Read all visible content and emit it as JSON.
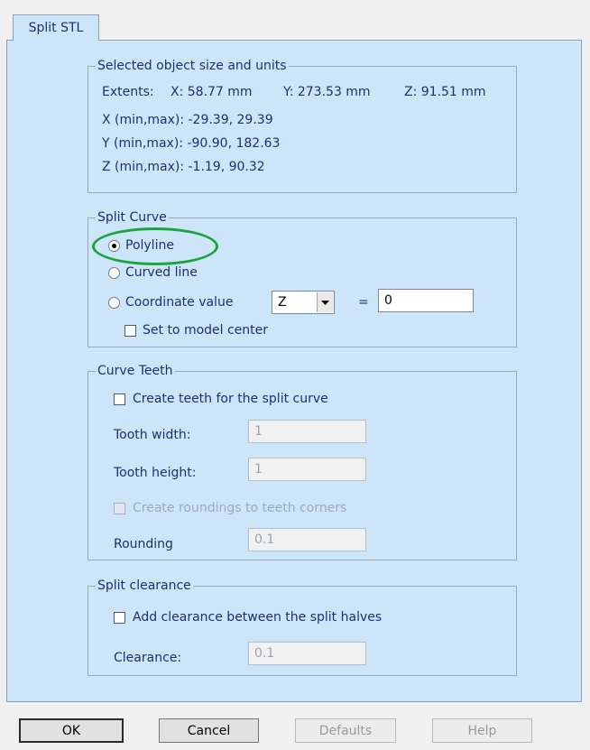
{
  "tab": {
    "label": "Split STL"
  },
  "object_info": {
    "legend": "Selected object size and units",
    "extents_label": "Extents:",
    "extents_x": "X: 58.77 mm",
    "extents_y": "Y: 273.53 mm",
    "extents_z": "Z: 91.51 mm",
    "x_range": "X (min,max): -29.39,  29.39",
    "y_range": "Y (min,max): -90.90,  182.63",
    "z_range": "Z (min,max): -1.19,  90.32"
  },
  "split_curve": {
    "legend": "Split Curve",
    "polyline_label": "Polyline",
    "curved_line_label": "Curved line",
    "coordinate_value_label": "Coordinate value",
    "axis_selected": "Z",
    "equals_sign": "=",
    "coordinate_value": "0",
    "set_to_center_label": "Set to model center",
    "selected_option": "Polyline"
  },
  "curve_teeth": {
    "legend": "Curve Teeth",
    "create_teeth_label": "Create teeth for the split curve",
    "tooth_width_label": "Tooth width:",
    "tooth_width_value": "1",
    "tooth_height_label": "Tooth height:",
    "tooth_height_value": "1",
    "roundings_label": "Create roundings to teeth corners",
    "rounding_label": "Rounding",
    "rounding_value": "0.1"
  },
  "split_clearance": {
    "legend": "Split clearance",
    "add_clearance_label": "Add clearance between the split halves",
    "clearance_label": "Clearance:",
    "clearance_value": "0.1"
  },
  "buttons": {
    "ok": "OK",
    "cancel": "Cancel",
    "defaults": "Defaults",
    "help": "Help"
  },
  "colors": {
    "panel_background": "#cce5f9",
    "label_text": "#1a3170",
    "highlight_annotation": "#1aa33c"
  }
}
